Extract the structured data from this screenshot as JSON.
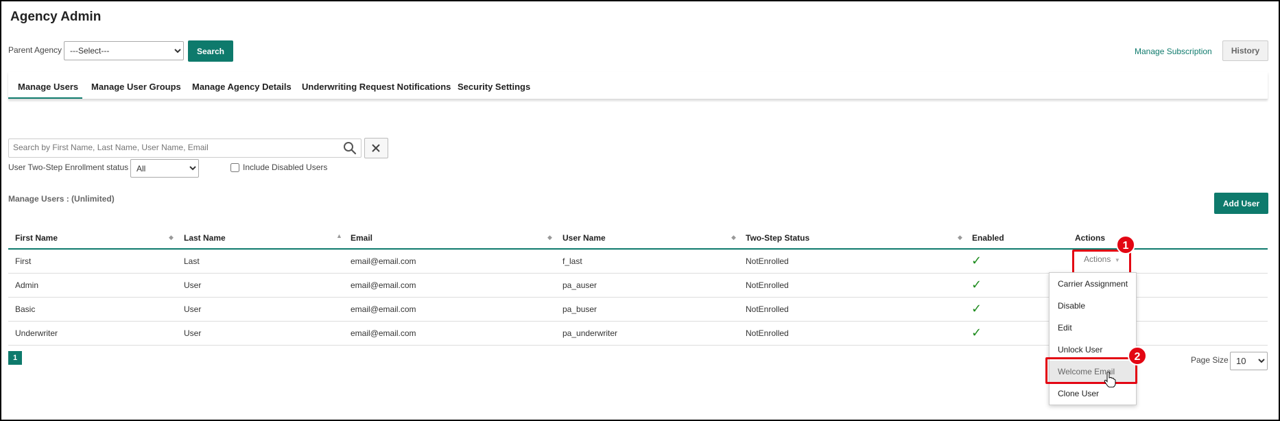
{
  "app": {
    "title": "Agency Admin"
  },
  "filter": {
    "parent_agency_label": "Parent Agency",
    "parent_agency_selected": "---Select---",
    "search_label": "Search"
  },
  "header_right": {
    "manage_subscription": "Manage Subscription",
    "history": "History"
  },
  "tabs": [
    {
      "label": "Manage Users",
      "active": true
    },
    {
      "label": "Manage User Groups"
    },
    {
      "label": "Manage Agency Details"
    },
    {
      "label": "Underwriting Request Notifications"
    },
    {
      "label": "Security Settings"
    }
  ],
  "user_search": {
    "placeholder": "Search by First Name, Last Name, User Name, Email",
    "enrollment_label": "User Two-Step Enrollment status",
    "enrollment_selected": "All",
    "include_disabled_label": "Include Disabled Users"
  },
  "section": {
    "title": "Manage Users : (Unlimited)",
    "add_user": "Add User"
  },
  "table": {
    "columns": [
      "First Name",
      "Last Name",
      "Email",
      "User Name",
      "Two-Step Status",
      "Enabled",
      "Actions"
    ],
    "rows": [
      {
        "first": "First",
        "last": "Last",
        "email": "email@email.com",
        "username": "f_last",
        "status": "NotEnrolled",
        "enabled": "✓"
      },
      {
        "first": "Admin",
        "last": "User",
        "email": "email@email.com",
        "username": "pa_auser",
        "status": "NotEnrolled",
        "enabled": "✓"
      },
      {
        "first": "Basic",
        "last": "User",
        "email": "email@email.com",
        "username": "pa_buser",
        "status": "NotEnrolled",
        "enabled": "✓"
      },
      {
        "first": "Underwriter",
        "last": "User",
        "email": "email@email.com",
        "username": "pa_underwriter",
        "status": "NotEnrolled",
        "enabled": "✓"
      }
    ],
    "actions_label": "Actions"
  },
  "actions_menu": [
    "Carrier Assignment",
    "Disable",
    "Edit",
    "Unlock User",
    "Welcome Email",
    "Clone User"
  ],
  "pagination": {
    "current_page": "1",
    "page_size_label": "Page Size",
    "page_size": "10"
  },
  "annotations": {
    "step1": "1",
    "step2": "2"
  },
  "colors": {
    "accent": "#0e7a6c",
    "highlight": "#e30613",
    "check": "#1a8a1a"
  }
}
